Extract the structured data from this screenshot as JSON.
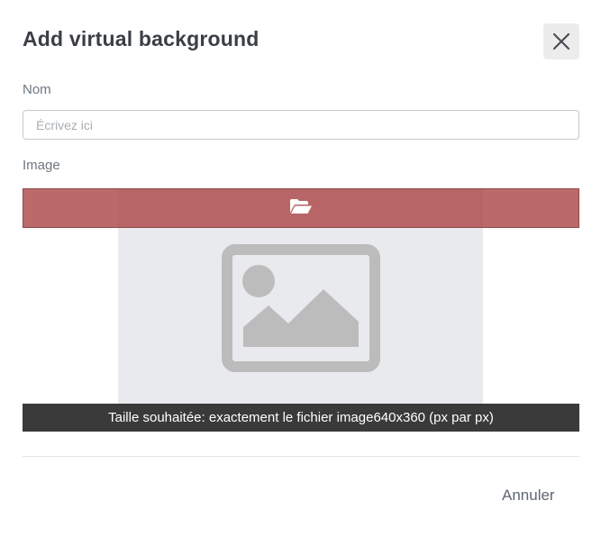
{
  "dialog": {
    "title": "Add virtual background",
    "close_icon": "close-icon"
  },
  "form": {
    "name_label": "Nom",
    "name_placeholder": "Écrivez ici",
    "name_value": "",
    "image_label": "Image",
    "upload_icon": "folder-open-icon",
    "preview_icon": "image-placeholder-icon",
    "size_hint": "Taille souhaitée: exactement le fichier image640x360 (px par px)"
  },
  "footer": {
    "cancel_label": "Annuler"
  },
  "colors": {
    "upload_bar": "#ac4848",
    "caption_bg": "#3a3a3a",
    "preview_bg": "#e8eaed"
  }
}
